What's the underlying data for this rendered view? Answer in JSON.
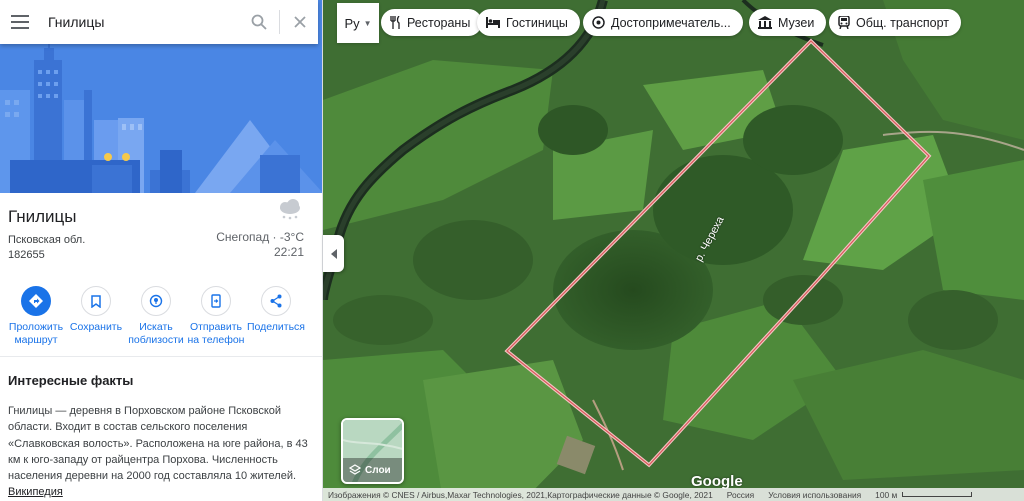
{
  "search": {
    "query": "Гнилицы"
  },
  "place": {
    "title": "Гнилицы",
    "region": "Псковская обл.",
    "postal_code": "182655"
  },
  "weather": {
    "condition": "Снегопад · -3°C",
    "time": "22:21"
  },
  "actions": [
    {
      "label_1": "Проложить",
      "label_2": "маршрут",
      "icon": "directions-icon"
    },
    {
      "label_1": "Сохранить",
      "label_2": "",
      "icon": "bookmark-icon"
    },
    {
      "label_1": "Искать",
      "label_2": "поблизости",
      "icon": "nearby-icon"
    },
    {
      "label_1": "Отправить",
      "label_2": "на телефон",
      "icon": "send-to-phone-icon"
    },
    {
      "label_1": "Поделиться",
      "label_2": "",
      "icon": "share-icon"
    }
  ],
  "facts": {
    "title": "Интересные факты",
    "text": "Гнилицы — деревня в Порховском районе Псковской области. Входит в состав сельского поселения «Славковская волость». Расположена на юге района, в 43 км к юго-западу от райцентра Порхова. Численность населения деревни на 2000 год составляла 10 жителей.",
    "source": "Википедия"
  },
  "map": {
    "language_button": "Ру",
    "chips": [
      {
        "label": "Рестораны",
        "icon": "restaurant-icon"
      },
      {
        "label": "Гостиницы",
        "icon": "hotel-icon"
      },
      {
        "label": "Достопримечатель...",
        "icon": "attraction-icon"
      },
      {
        "label": "Музеи",
        "icon": "museum-icon"
      },
      {
        "label": "Общ. транспорт",
        "icon": "transit-icon"
      }
    ],
    "river_label": "р. Череха",
    "layers_label": "Слои",
    "logo": "Google",
    "footer": {
      "attribution": "Изображения © CNES / Airbus,Maxar Technologies, 2021,Картографические данные © Google, 2021",
      "country": "Россия",
      "terms": "Условия использования",
      "scale": "100 м"
    }
  },
  "colors": {
    "accent": "#1a73e8",
    "hero_sky": "#4a86e4",
    "boundary": "#e8a3a3"
  }
}
